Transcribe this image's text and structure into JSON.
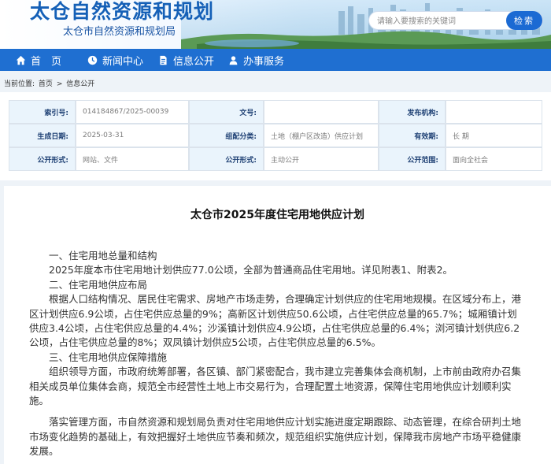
{
  "header": {
    "title": "太仓自然资源和规划",
    "subtitle": "太仓市自然资源和规划局",
    "search": {
      "placeholder": "请输入要搜索的关键词",
      "button": "检索"
    }
  },
  "nav": [
    {
      "label": "首　页",
      "icon": "home-icon"
    },
    {
      "label": "新闻中心",
      "icon": "news-icon"
    },
    {
      "label": "信息公开",
      "icon": "document-icon"
    },
    {
      "label": "办事服务",
      "icon": "service-icon"
    }
  ],
  "breadcrumb": {
    "prefix": "当前位置:",
    "items": [
      "首页",
      "信息公开"
    ],
    "sep": ">"
  },
  "meta": {
    "rows": [
      [
        {
          "label": "索引号:",
          "value": "014184867/2025-00039"
        },
        {
          "label": "文号:",
          "value": ""
        },
        {
          "label": "发布机构:",
          "value": ""
        }
      ],
      [
        {
          "label": "生成日期:",
          "value": "2025-03-31"
        },
        {
          "label": "组配分类:",
          "value": "土地（棚户区改造）供应计划"
        },
        {
          "label": "有效期:",
          "value": "长 期"
        }
      ],
      [
        {
          "label": "公开形式:",
          "value": "网站、文件"
        },
        {
          "label": "公开形式:",
          "value": "主动公开"
        },
        {
          "label": "公开范围:",
          "value": "面向全社会"
        }
      ]
    ]
  },
  "article": {
    "title": "太仓市2025年度住宅用地供应计划",
    "paragraphs": [
      "一、住宅用地总量和结构",
      "2025年度本市住宅用地计划供应77.0公顷，全部为普通商品住宅用地。详见附表1、附表2。",
      "二、住宅用地供应布局",
      "根据人口结构情况、居民住宅需求、房地产市场走势，合理确定计划供应的住宅用地规模。在区域分布上，港区计划供应6.9公顷，占住宅供应总量的9%；高新区计划供应50.6公顷，占住宅供应总量的65.7%；城厢镇计划供应3.4公顷，占住宅供应总量的4.4%；沙溪镇计划供应4.9公顷，占住宅供应总量的6.4%；浏河镇计划供应6.2公顷，占住宅供应总量的8%；双凤镇计划供应5公顷，占住宅供应总量的6.5%。",
      "三、住宅用地供应保障措施",
      "组织领导方面，市政府统筹部署，各区镇、部门紧密配合，我市建立完善集体会商机制，上市前由政府办召集相关成员单位集体会商，规范全市经营性土地上市交易行为，合理配置土地资源，保障住宅用地供应计划顺利实施。",
      "落实管理方面，市自然资源和规划局负责对住宅用地供应计划实施进度定期跟踪、动态管理，在综合研判土地市场变化趋势的基础上，有效把握好土地供应节奏和频次，规范组织实施供应计划，保障我市房地产市场平稳健康发展。"
    ]
  },
  "colors": {
    "nav": "#1f6fd1",
    "title": "#1560b7",
    "label_bg": "#eaf4fc",
    "page_bg": "#eef3f8"
  }
}
